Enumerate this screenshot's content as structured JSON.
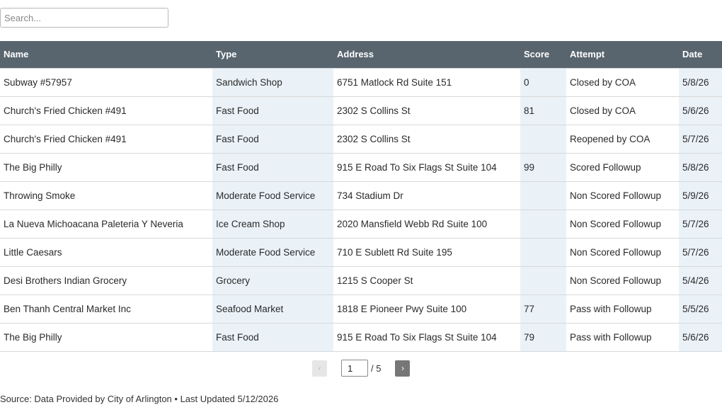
{
  "search": {
    "placeholder": "Search..."
  },
  "table": {
    "headers": [
      "Name",
      "Type",
      "Address",
      "Score",
      "Attempt",
      "Date"
    ],
    "rows": [
      [
        "Subway #57957",
        "Sandwich Shop",
        "6751 Matlock Rd Suite 151",
        "0",
        "Closed by COA",
        "5/8/26"
      ],
      [
        "Church's Fried Chicken #491",
        "Fast Food",
        "2302 S Collins St",
        "81",
        "Closed by COA",
        "5/6/26"
      ],
      [
        "Church's Fried Chicken #491",
        "Fast Food",
        "2302 S Collins St",
        "",
        "Reopened by COA",
        "5/7/26"
      ],
      [
        "The Big Philly",
        "Fast Food",
        "915 E Road To Six Flags St Suite 104",
        "99",
        "Scored Followup",
        "5/8/26"
      ],
      [
        "Throwing Smoke",
        "Moderate Food Service",
        "734 Stadium Dr",
        "",
        "Non Scored Followup",
        "5/9/26"
      ],
      [
        "La Nueva Michoacana Paleteria Y Neveria",
        "Ice Cream Shop",
        "2020 Mansfield Webb Rd Suite 100",
        "",
        "Non Scored Followup",
        "5/7/26"
      ],
      [
        "Little Caesars",
        "Moderate Food Service",
        "710 E Sublett Rd Suite 195",
        "",
        "Non Scored Followup",
        "5/7/26"
      ],
      [
        "Desi Brothers Indian Grocery",
        "Grocery",
        "1215 S Cooper St",
        "",
        "Non Scored Followup",
        "5/4/26"
      ],
      [
        "Ben Thanh Central Market Inc",
        "Seafood Market",
        "1818 E Pioneer Pwy Suite 100",
        "77",
        "Pass with Followup",
        "5/5/26"
      ],
      [
        "The Big Philly",
        "Fast Food",
        "915 E Road To Six Flags St Suite 104",
        "79",
        "Pass with Followup",
        "5/6/26"
      ]
    ]
  },
  "pagination": {
    "prev_label": "‹",
    "next_label": "›",
    "current_page": "1",
    "total_label": "/ 5"
  },
  "footer": {
    "text": "Source: Data Provided by City of Arlington • Last Updated 5/12/2026"
  },
  "colors": {
    "header_bg": "#58656f",
    "shaded_column": "#eaf2f8",
    "next_button": "#777777"
  }
}
